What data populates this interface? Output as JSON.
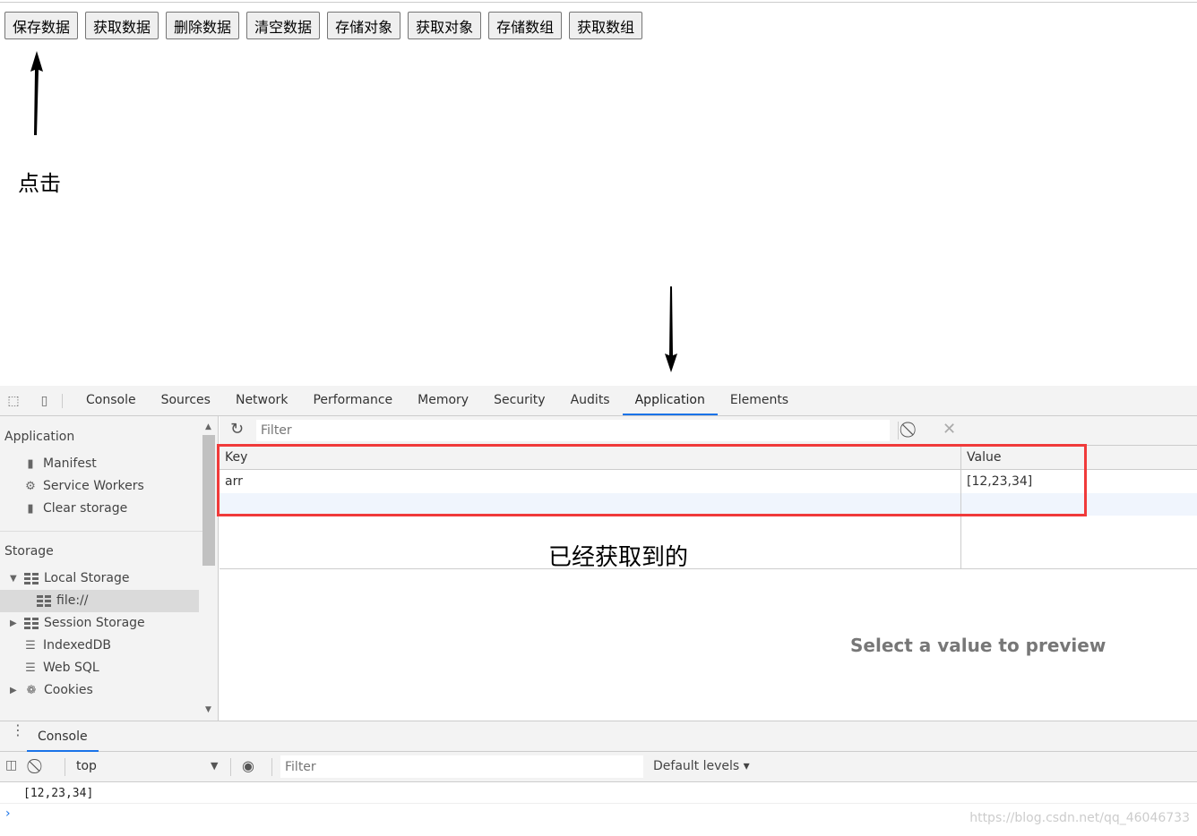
{
  "page": {
    "buttons": [
      "保存数据",
      "获取数据",
      "删除数据",
      "清空数据",
      "存储对象",
      "获取对象",
      "存储数组",
      "获取数组"
    ],
    "click_annotation": "点击",
    "got_annotation": "已经获取到的"
  },
  "devtools": {
    "tabs": [
      "Console",
      "Sources",
      "Network",
      "Performance",
      "Memory",
      "Security",
      "Audits",
      "Application",
      "Elements"
    ],
    "active_tab": "Application",
    "sidebar": {
      "application_header": "Application",
      "application_items": [
        "Manifest",
        "Service Workers",
        "Clear storage"
      ],
      "storage_header": "Storage",
      "local_storage": "Local Storage",
      "local_origin": "file://",
      "session_storage": "Session Storage",
      "indexeddb": "IndexedDB",
      "websql": "Web SQL",
      "cookies": "Cookies"
    },
    "toolbar": {
      "filter_placeholder": "Filter"
    },
    "table": {
      "headers": [
        "Key",
        "Value"
      ],
      "rows": [
        {
          "key": "arr",
          "value": "[12,23,34]"
        }
      ]
    },
    "preview": "Select a value to preview"
  },
  "console": {
    "tab": "Console",
    "context": "top",
    "filter_placeholder": "Filter",
    "levels": "Default levels ▾",
    "output": "[12,23,34]",
    "prompt": "›"
  },
  "watermark": "https://blog.csdn.net/qq_46046733",
  "colors": {
    "accent": "#1a73e8",
    "highlight_box": "#f03a3a"
  }
}
